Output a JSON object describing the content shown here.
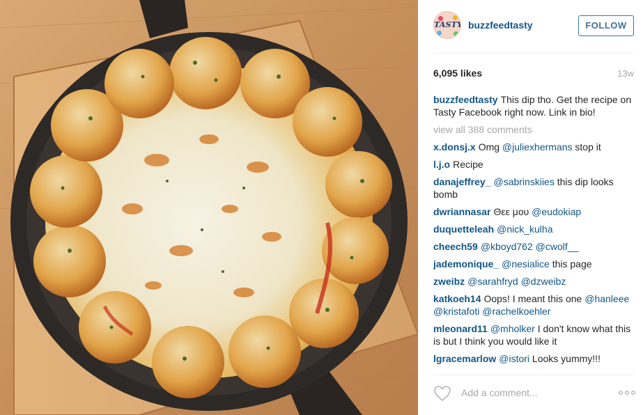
{
  "post": {
    "image": {
      "alt": "cheese dip skillet photo"
    },
    "author": {
      "username": "buzzfeedtasty",
      "avatar_text": "TASTY",
      "avatar_icon": "tasty-logo-avatar"
    },
    "follow_label": "FOLLOW",
    "likes": "6,095 likes",
    "time_ago": "13w",
    "caption": {
      "username": "buzzfeedtasty",
      "text": "This dip tho. Get the recipe on Tasty Facebook right now. Link in bio!"
    },
    "view_all": "view all 388 comments",
    "comments": [
      {
        "user": "x.donsj.x",
        "parts": [
          {
            "t": "Omg "
          },
          {
            "m": "@juliexhermans"
          },
          {
            "t": " stop it"
          }
        ]
      },
      {
        "user": "l.j.o",
        "parts": [
          {
            "t": "Recipe"
          }
        ]
      },
      {
        "user": "danajeffrey_",
        "parts": [
          {
            "m": "@sabrinskiies"
          },
          {
            "t": " this dip looks bomb"
          }
        ]
      },
      {
        "user": "dwriannasar",
        "parts": [
          {
            "t": "Θεε μου "
          },
          {
            "m": "@eudokiap"
          }
        ]
      },
      {
        "user": "duquetteleah",
        "parts": [
          {
            "m": "@nick_kulha"
          }
        ]
      },
      {
        "user": "cheech59",
        "parts": [
          {
            "m": "@kboyd762"
          },
          {
            "t": " "
          },
          {
            "m": "@cwolf__"
          }
        ]
      },
      {
        "user": "jademonique_",
        "parts": [
          {
            "m": "@nesialice"
          },
          {
            "t": " this page"
          }
        ]
      },
      {
        "user": "zweibz",
        "parts": [
          {
            "m": "@sarahfryd"
          },
          {
            "t": " "
          },
          {
            "m": "@dzweibz"
          }
        ]
      },
      {
        "user": "katkoeh14",
        "parts": [
          {
            "t": "Oops! I meant this one "
          },
          {
            "m": "@hanleee"
          },
          {
            "t": " "
          },
          {
            "m": "@kristafoti"
          },
          {
            "t": " "
          },
          {
            "m": "@rachelkoehler"
          }
        ]
      },
      {
        "user": "mleonard11",
        "parts": [
          {
            "m": "@mholker"
          },
          {
            "t": " I don't know what this is but I think you would like it"
          }
        ]
      },
      {
        "user": "lgracemarlow",
        "parts": [
          {
            "m": "@istori"
          },
          {
            "t": " Looks yummy!!!"
          }
        ]
      }
    ],
    "add_comment_placeholder": "Add a comment...",
    "icons": {
      "like": "heart-outline-icon",
      "more": "more-options-icon"
    },
    "colors": {
      "link": "#125688",
      "follow": "#3f729b",
      "muted": "#a5a7aa",
      "text": "#262626"
    }
  }
}
